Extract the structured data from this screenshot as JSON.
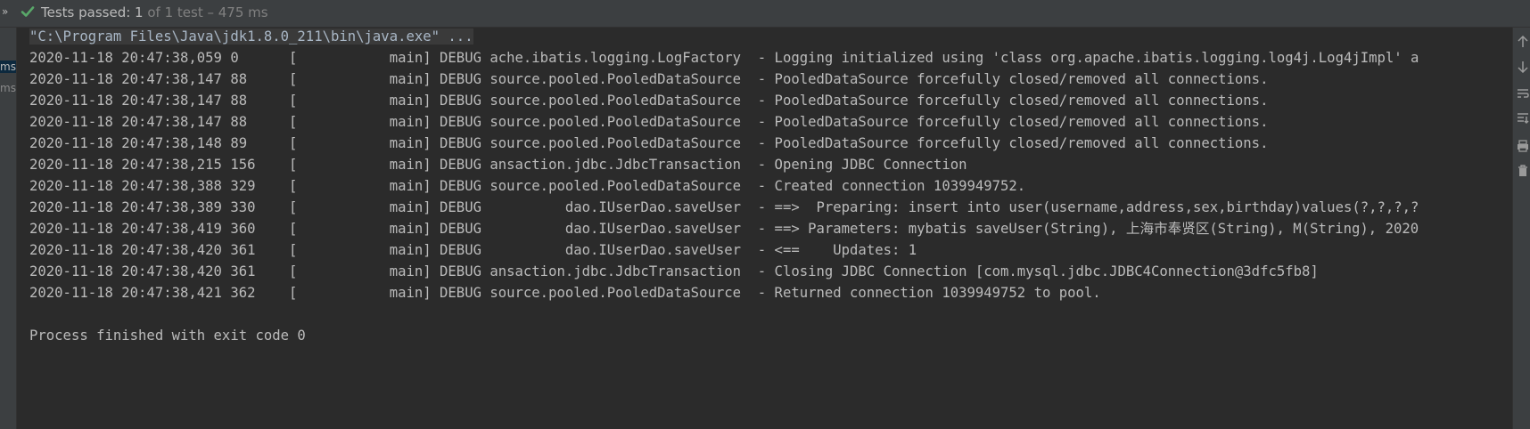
{
  "header": {
    "expand_icon": "»",
    "status_main": "Tests passed: 1",
    "status_detail": "of 1 test – 475 ms",
    "pass_color": "#59a869"
  },
  "tree": {
    "times": [
      "ms",
      "ms"
    ]
  },
  "console": {
    "command": "\"C:\\Program Files\\Java\\jdk1.8.0_211\\bin\\java.exe\" ...",
    "log_lines": [
      "2020-11-18 20:47:38,059 0      [           main] DEBUG ache.ibatis.logging.LogFactory  - Logging initialized using 'class org.apache.ibatis.logging.log4j.Log4jImpl' a",
      "2020-11-18 20:47:38,147 88     [           main] DEBUG source.pooled.PooledDataSource  - PooledDataSource forcefully closed/removed all connections.",
      "2020-11-18 20:47:38,147 88     [           main] DEBUG source.pooled.PooledDataSource  - PooledDataSource forcefully closed/removed all connections.",
      "2020-11-18 20:47:38,147 88     [           main] DEBUG source.pooled.PooledDataSource  - PooledDataSource forcefully closed/removed all connections.",
      "2020-11-18 20:47:38,148 89     [           main] DEBUG source.pooled.PooledDataSource  - PooledDataSource forcefully closed/removed all connections.",
      "2020-11-18 20:47:38,215 156    [           main] DEBUG ansaction.jdbc.JdbcTransaction  - Opening JDBC Connection",
      "2020-11-18 20:47:38,388 329    [           main] DEBUG source.pooled.PooledDataSource  - Created connection 1039949752.",
      "2020-11-18 20:47:38,389 330    [           main] DEBUG          dao.IUserDao.saveUser  - ==>  Preparing: insert into user(username,address,sex,birthday)values(?,?,?,?",
      "2020-11-18 20:47:38,419 360    [           main] DEBUG          dao.IUserDao.saveUser  - ==> Parameters: mybatis saveUser(String), 上海市奉贤区(String), M(String), 2020",
      "2020-11-18 20:47:38,420 361    [           main] DEBUG          dao.IUserDao.saveUser  - <==    Updates: 1",
      "2020-11-18 20:47:38,420 361    [           main] DEBUG ansaction.jdbc.JdbcTransaction  - Closing JDBC Connection [com.mysql.jdbc.JDBC4Connection@3dfc5fb8]",
      "2020-11-18 20:47:38,421 362    [           main] DEBUG source.pooled.PooledDataSource  - Returned connection 1039949752 to pool."
    ],
    "exit_message": "Process finished with exit code 0"
  },
  "toolbar_icons": [
    "up-arrow-icon",
    "down-arrow-icon",
    "soft-wrap-icon",
    "scroll-to-end-icon",
    "print-icon",
    "trash-icon"
  ]
}
